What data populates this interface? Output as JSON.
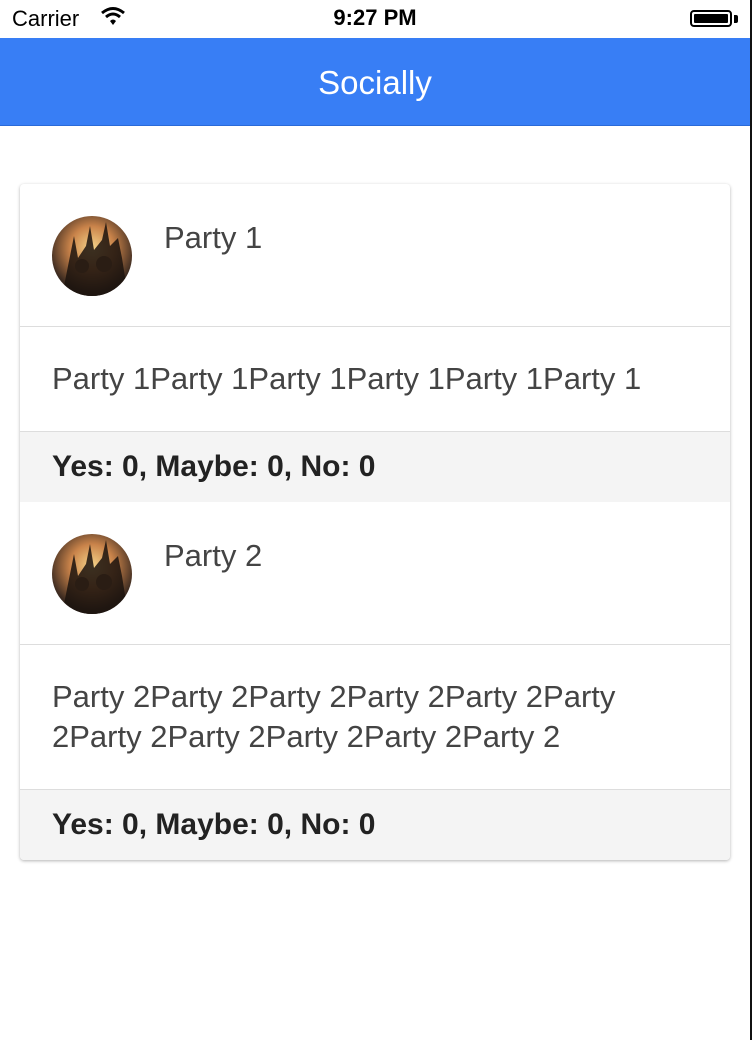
{
  "status_bar": {
    "carrier": "Carrier",
    "time": "9:27 PM",
    "battery_level": 1.0
  },
  "nav": {
    "title": "Socially"
  },
  "parties": [
    {
      "name": "Party 1",
      "description": "Party 1Party 1Party 1Party 1Party 1Party 1",
      "rsvp": "Yes: 0, Maybe: 0, No: 0",
      "avatar_icon": "crowd-photo"
    },
    {
      "name": "Party 2",
      "description": "Party 2Party 2Party 2Party 2Party 2Party 2Party 2Party 2Party 2Party 2Party 2",
      "rsvp": "Yes: 0, Maybe: 0, No: 0",
      "avatar_icon": "crowd-photo"
    }
  ],
  "colors": {
    "nav_bar": "#387ef5",
    "rsvp_bar": "#f4f4f4"
  }
}
